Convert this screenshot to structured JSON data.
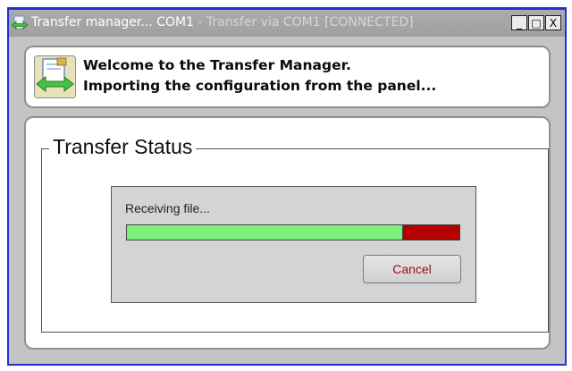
{
  "window": {
    "title_main": "Transfer manager... COM1",
    "title_suffix": " - Transfer via COM1 [CONNECTED]",
    "buttons": {
      "minimize": "_",
      "maximize": "□",
      "close": "X"
    }
  },
  "header": {
    "line1": "Welcome to the Transfer Manager.",
    "line2": "Importing the configuration from the panel..."
  },
  "transfer_status": {
    "group_label": "Transfer Status",
    "progress_text": "Receiving file...",
    "progress_fraction": 0.83,
    "cancel_label": "Cancel"
  },
  "icons": {
    "app": "transfer-arrows-icon",
    "header": "document-transfer-icon"
  },
  "colors": {
    "window_border": "#1c33d8",
    "progress_fill": "#7ef07c",
    "progress_remaining": "#b30000",
    "cancel_text": "#a01010"
  }
}
